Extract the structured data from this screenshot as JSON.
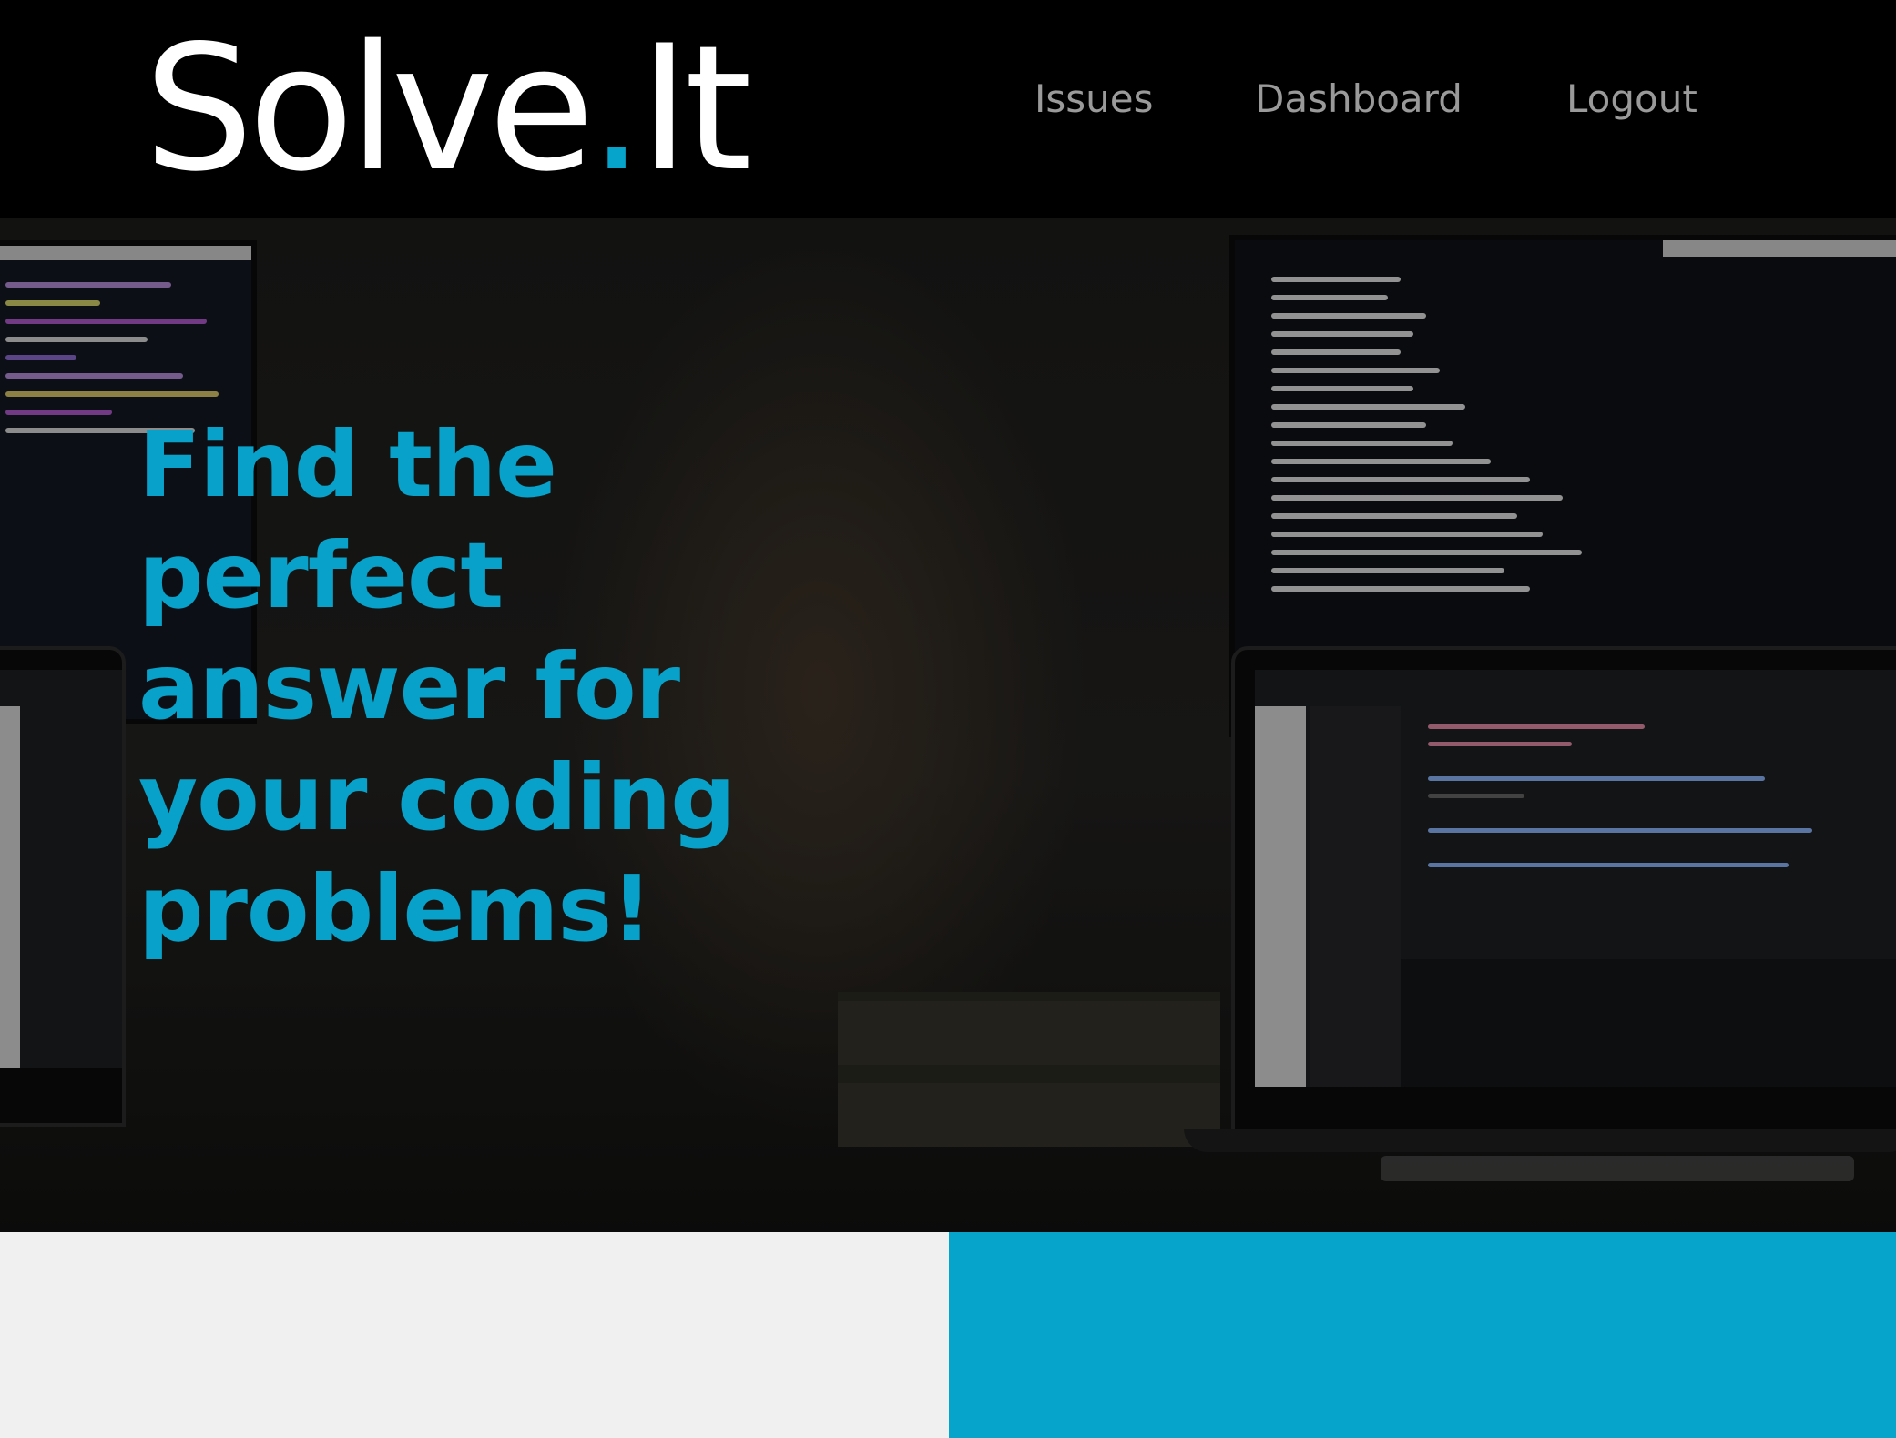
{
  "header": {
    "logo": {
      "name": "Solve",
      "dot": ".",
      "suffix": "It"
    },
    "nav": [
      {
        "label": "Issues"
      },
      {
        "label": "Dashboard"
      },
      {
        "label": "Logout"
      }
    ]
  },
  "hero": {
    "title_lines": [
      "Find the",
      "perfect",
      "answer for",
      "your coding",
      "problems!"
    ]
  },
  "colors": {
    "accent": "#06a3ca",
    "header_bg": "#000000",
    "nav_text": "#9a9a9a",
    "panel_left": "#f0f0f0",
    "panel_right": "#06a3ca"
  }
}
